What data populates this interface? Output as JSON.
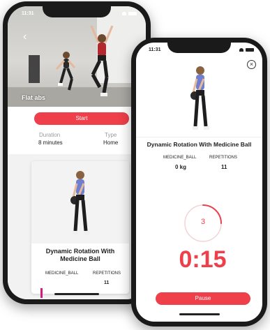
{
  "back_phone": {
    "status_time": "11:31",
    "workout_title": "Flat abs",
    "start_label": "Start",
    "duration_label": "Duration",
    "duration_value": "8 minutes",
    "type_label": "Type",
    "type_value": "Home",
    "card": {
      "title": "Dynamic Rotation With Medicine Ball",
      "equipment_label": "MEDICINE_BALL",
      "reps_label": "REPETITIONS",
      "reps_value": "11"
    }
  },
  "front_phone": {
    "status_time": "11:31",
    "exercise_title": "Dynamic Rotation With Medicine Ball",
    "equipment_label": "MEDICINE_BALL",
    "weight_value": "0 kg",
    "reps_label": "REPETITIONS",
    "reps_value": "11",
    "countdown_value": "3",
    "countdown_progress": 0.25,
    "timer_value": "0:15",
    "pause_label": "Pause"
  },
  "colors": {
    "accent": "#ee3f4b",
    "ring_track": "#f3d3d6"
  }
}
